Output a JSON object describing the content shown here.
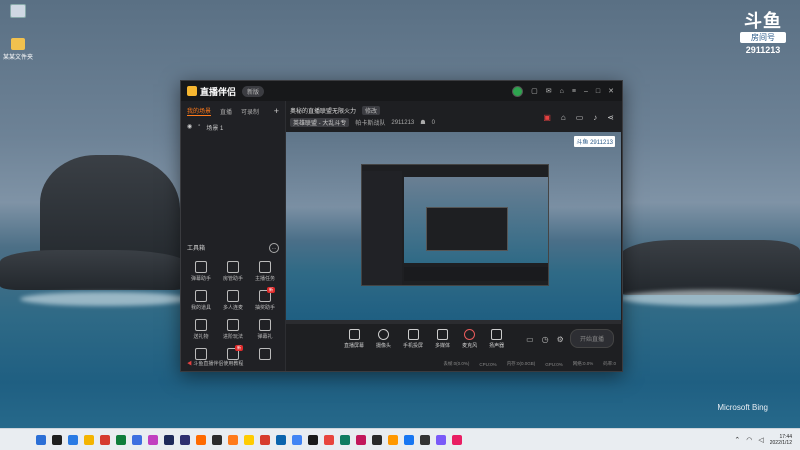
{
  "desktop": {
    "icons": [
      {
        "name": "recycle-bin-icon",
        "label": ""
      },
      {
        "name": "folder-icon",
        "label": "某某文件夹"
      }
    ],
    "brand": {
      "logo": "斗鱼",
      "room_label": "房间号",
      "room_number": "2911213"
    },
    "wallpaper_credit": "Microsoft Bing"
  },
  "app": {
    "name": "直播伴侣",
    "version_badge": "新版",
    "left_tabs": [
      "我的场景",
      "直播",
      "可录制"
    ],
    "add_tab": "+",
    "scene_item": "场景 1",
    "tools_title": "工具箱",
    "tools": [
      {
        "label": "弹幕助手",
        "icon": "danmaku-icon",
        "badge": ""
      },
      {
        "label": "房管助手",
        "icon": "admin-icon",
        "badge": ""
      },
      {
        "label": "主播任务",
        "icon": "task-icon",
        "badge": ""
      },
      {
        "label": "我的道具",
        "icon": "props-icon",
        "badge": ""
      },
      {
        "label": "多人连麦",
        "icon": "multi-mic-icon",
        "badge": ""
      },
      {
        "label": "抽奖助手",
        "icon": "lottery-icon",
        "badge": "新"
      },
      {
        "label": "送礼物",
        "icon": "gift-icon",
        "badge": ""
      },
      {
        "label": "进阶玩法",
        "icon": "advanced-icon",
        "badge": ""
      },
      {
        "label": "弹幕礼",
        "icon": "danmaku-gift-icon",
        "badge": ""
      },
      {
        "label": "",
        "icon": "chart-icon",
        "badge": ""
      },
      {
        "label": "",
        "icon": "game-icon",
        "badge": "新"
      },
      {
        "label": "",
        "icon": "music-icon",
        "badge": ""
      }
    ],
    "bottom_tip": "斗鱼直播伴侣使用教程",
    "stream_title": "奥秘的直播联盟无限火力",
    "edit_label": "修改",
    "category": "英雄联盟 - 大乱斗专",
    "host_name": "帕卡斯战队",
    "room_number": "2911213",
    "followers": "0",
    "preview_brand": "斗鱼 2911213",
    "controls": [
      {
        "label": "直播屏幕",
        "icon": "screen-icon"
      },
      {
        "label": "摄像头",
        "icon": "camera-icon"
      },
      {
        "label": "手机投屏",
        "icon": "phone-cast-icon"
      },
      {
        "label": "多媒体",
        "icon": "media-icon"
      },
      {
        "label": "麦克风",
        "icon": "microphone-icon"
      },
      {
        "label": "扬声器",
        "icon": "speaker-icon"
      }
    ],
    "go_live": "开始直播",
    "status": [
      "丢帧:0(0.0%)",
      "CPU:0%",
      "内存:0(0.0GB)",
      "GPU:0%",
      "网络:0.0%",
      "码率:0"
    ]
  },
  "taskbar": {
    "time": "17:44",
    "date": "2022/1/12",
    "app_icon_colors": [
      "#2b6fd6",
      "#1f1f1f",
      "#2a7be4",
      "#f4b400",
      "#d63b2f",
      "#0f7d3b",
      "#3d6fe0",
      "#c13fbf",
      "#1e2a5a",
      "#2f2f6e",
      "#ff6a00",
      "#2c2c2c",
      "#ff7a1a",
      "#ffcc00",
      "#d73c2c",
      "#0a64ad",
      "#4285f4",
      "#1a1a1a",
      "#e8453c",
      "#0e7c61",
      "#c2185b",
      "#2a2a2a",
      "#ff9800",
      "#1877f2",
      "#333333",
      "#7a5af8",
      "#e91e63"
    ]
  }
}
